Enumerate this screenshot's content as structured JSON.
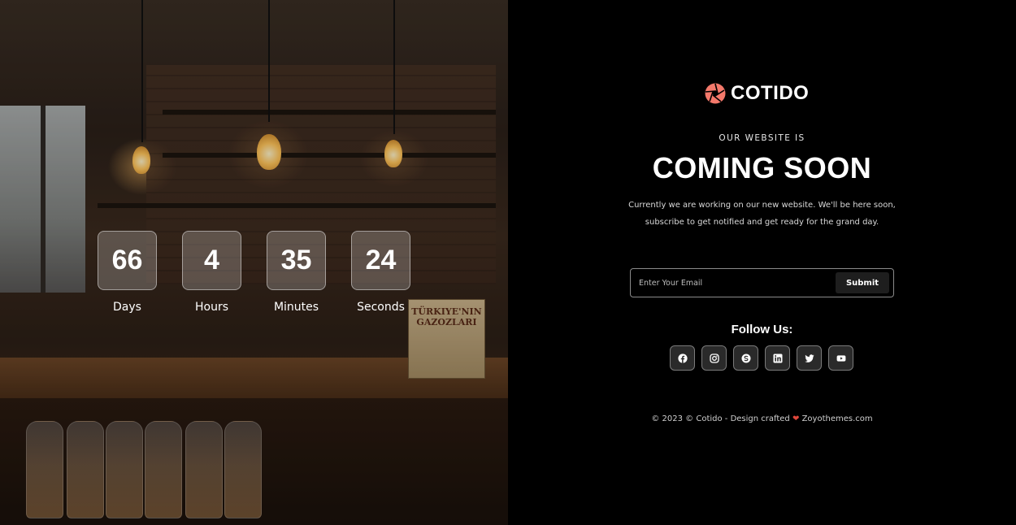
{
  "countdown": [
    {
      "value": "66",
      "label": "Days"
    },
    {
      "value": "4",
      "label": "Hours"
    },
    {
      "value": "35",
      "label": "Minutes"
    },
    {
      "value": "24",
      "label": "Seconds"
    }
  ],
  "photo": {
    "box_label": "TÜRKIYE'NIN GAZOZLARI"
  },
  "brand": {
    "name": "COTIDO",
    "accent_color": "#f4796b"
  },
  "hero": {
    "eyebrow": "OUR WEBSITE IS",
    "headline": "COMING SOON",
    "description_line1": "Currently we are working on our new website. We'll be here soon,",
    "description_line2": "subscribe to get notified and get ready for the grand day."
  },
  "subscribe": {
    "placeholder": "Enter Your Email",
    "value": "",
    "button_label": "Submit"
  },
  "social": {
    "title": "Follow Us:",
    "icons": [
      "facebook-icon",
      "instagram-icon",
      "skype-icon",
      "linkedin-icon",
      "twitter-icon",
      "youtube-icon"
    ]
  },
  "footer": {
    "prefix": "© 2023 © Cotido - Design crafted",
    "heart": "❤",
    "suffix": "Zoyothemes.com"
  }
}
